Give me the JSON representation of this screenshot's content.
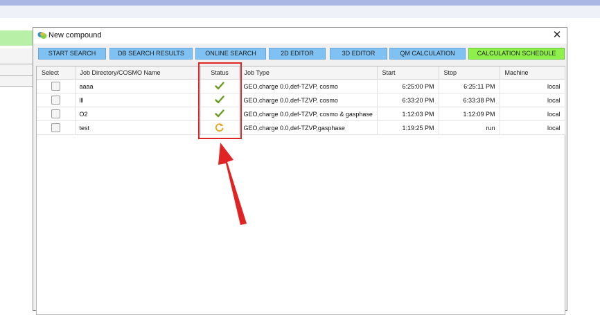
{
  "window": {
    "title": "New compound",
    "close_glyph": "✕"
  },
  "tabs": [
    {
      "label": "START SEARCH",
      "active": false
    },
    {
      "label": "DB SEARCH RESULTS",
      "active": false
    },
    {
      "label": "ONLINE SEARCH",
      "active": false
    },
    {
      "label": "2D EDITOR",
      "active": false
    },
    {
      "label": "3D EDITOR",
      "active": false
    },
    {
      "label": "QM CALCULATION",
      "active": false
    },
    {
      "label": "CALCULATION SCHEDULE",
      "active": true
    }
  ],
  "table": {
    "columns": {
      "select": "Select",
      "job_dir": "Job Directory/COSMO Name",
      "status": "Status",
      "job_type": "Job Type",
      "start": "Start",
      "stop": "Stop",
      "machine": "Machine"
    },
    "rows": [
      {
        "name": "aaaa",
        "status_icon": "checkmark-icon",
        "job_type": "GEO,charge 0.0,def-TZVP, cosmo",
        "start": "6:25:00 PM",
        "stop": "6:25:11 PM",
        "machine": "local"
      },
      {
        "name": "lll",
        "status_icon": "checkmark-icon",
        "job_type": "GEO,charge 0.0,def-TZVP, cosmo",
        "start": "6:33:20 PM",
        "stop": "6:33:38 PM",
        "machine": "local"
      },
      {
        "name": "O2",
        "status_icon": "checkmark-icon",
        "job_type": "GEO,charge 0.0,def-TZVP, cosmo & gasphase",
        "start": "1:12:03 PM",
        "stop": "1:12:09 PM",
        "machine": "local"
      },
      {
        "name": "test",
        "status_icon": "running-icon",
        "job_type": "GEO,charge 0.0,def-TZVP,gasphase",
        "start": "1:19:25 PM",
        "stop": "run",
        "machine": "local"
      }
    ]
  },
  "colors": {
    "tab": "#7ec1f2",
    "tab_active": "#8ef04b",
    "check": "#6a9a1f",
    "running": "#e8a317",
    "annotation": "#e02424"
  }
}
